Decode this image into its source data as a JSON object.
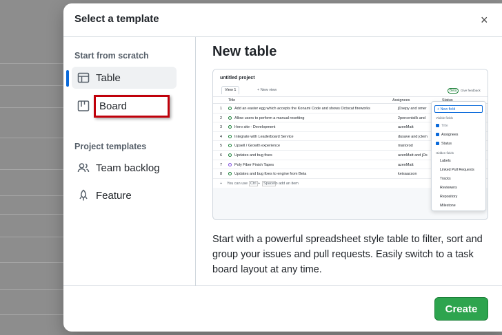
{
  "dialog": {
    "title": "Select a template",
    "close_icon": "×"
  },
  "sidebar": {
    "scratch_heading": "Start from scratch",
    "scratch_items": [
      {
        "label": "Table",
        "icon": "table-icon",
        "active": true
      },
      {
        "label": "Board",
        "icon": "board-icon"
      }
    ],
    "templates_heading": "Project templates",
    "template_items": [
      {
        "label": "Team backlog",
        "icon": "people-icon"
      },
      {
        "label": "Feature",
        "icon": "rocket-icon"
      }
    ]
  },
  "main": {
    "title": "New table",
    "description": "Start with a powerful spreadsheet style table to filter, sort and group your issues and pull requests. Easily switch to a task board layout at any time."
  },
  "preview": {
    "project": "untitled project",
    "view_tab": "View 1",
    "new_view": "+ New view",
    "col_title": "Title",
    "col_assignees": "Assignees",
    "col_status": "Status",
    "beta": "Beta",
    "feedback": "Give feedback",
    "rows": [
      {
        "n": "1",
        "title": "Add an easter egg which accepts the Konami Code and shows Octocat fireworks",
        "assignee": "jDsepy and omer"
      },
      {
        "n": "2",
        "title": "Allow users to perform a manual resetting",
        "assignee": "2percentsilk and"
      },
      {
        "n": "3",
        "title": "Hero site - Development",
        "assignee": "azenMatt"
      },
      {
        "n": "4",
        "title": "Integrate with Leaderboard Service",
        "assignee": "dusave and jclem"
      },
      {
        "n": "5",
        "title": "Upsell / Growth experience",
        "assignee": "mariorod"
      },
      {
        "n": "6",
        "title": "Updates and bug fixes",
        "assignee": "azenMatt and jDs"
      },
      {
        "n": "7",
        "title": "Poly Fiber Finish Tapes",
        "assignee": "azenMatt"
      },
      {
        "n": "8",
        "title": "Updates and bug fixes to engine from Beta",
        "assignee": "keisaacson"
      }
    ],
    "add_hint_a": "You can use",
    "key_ctrl": "Ctrl",
    "key_space": "Space",
    "add_hint_b": "to add an item",
    "dropdown": {
      "new_field": "+ New field",
      "visible_heading": "Visible fields",
      "visible": [
        "Title",
        "Assignees",
        "Status"
      ],
      "hidden_heading": "Hidden fields",
      "hidden": [
        "Labels",
        "Linked Pull Requests",
        "Tracks",
        "Reviewers",
        "Repository",
        "Milestone"
      ]
    }
  },
  "footer": {
    "create_label": "Create"
  },
  "colors": {
    "primary": "#2da44e",
    "accent": "#0969da",
    "highlight": "#c0000a"
  }
}
